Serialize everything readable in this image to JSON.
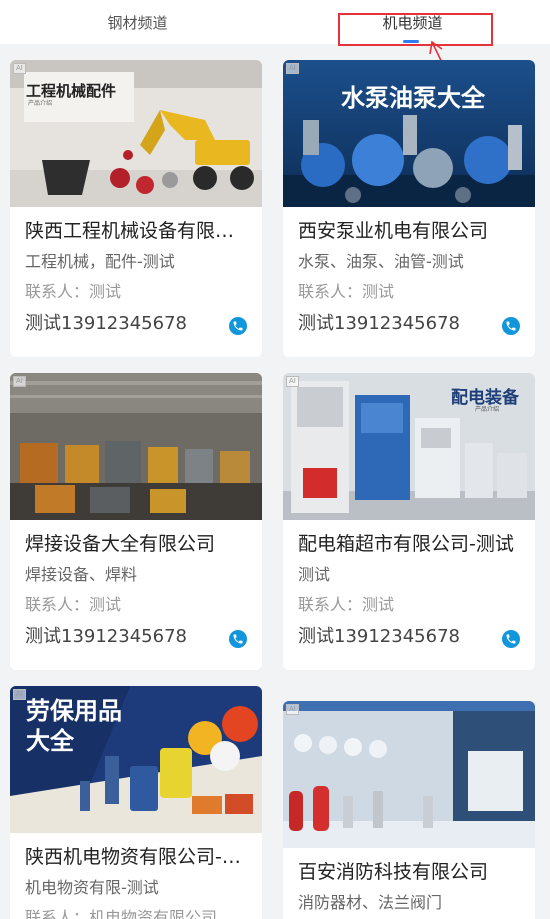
{
  "tabs": [
    {
      "label": "钢材频道"
    },
    {
      "label": "机电频道"
    }
  ],
  "active_tab": 1,
  "colors": {
    "accent": "#2e7cf6",
    "call_icon": "#1296db",
    "annotation": "#e5333c"
  },
  "cards": [
    {
      "image_label": "工程机械配件",
      "image_sublabel": "产品介绍",
      "image_badge": "AI",
      "name": "陕西工程机械设备有限公司",
      "category": "工程机械，配件-测试",
      "contact": "联系人：测试",
      "phone": "测试13912345678"
    },
    {
      "image_label": "水泵油泵大全",
      "image_badge": "AI",
      "name": "西安泵业机电有限公司",
      "category": "水泵、油泵、油管-测试",
      "contact": "联系人：测试",
      "phone": "测试13912345678"
    },
    {
      "image_badge": "AI",
      "name": "焊接设备大全有限公司",
      "category": "焊接设备、焊料",
      "contact": "联系人：测试",
      "phone": "测试13912345678"
    },
    {
      "image_label": "配电装备",
      "image_sublabel": "产品介绍",
      "image_badge": "AI",
      "name": "配电箱超市有限公司-测试",
      "category": "测试",
      "contact": "联系人：测试",
      "phone": "测试13912345678"
    },
    {
      "image_label": "劳保用品大全",
      "image_badge": "AI",
      "name": "陕西机电物资有限公司-测试",
      "category": "机电物资有限-测试",
      "contact": "联系人：机电物资有限公司"
    },
    {
      "image_badge": "AI",
      "name": "百安消防科技有限公司",
      "category": "消防器材、法兰阀门"
    }
  ]
}
